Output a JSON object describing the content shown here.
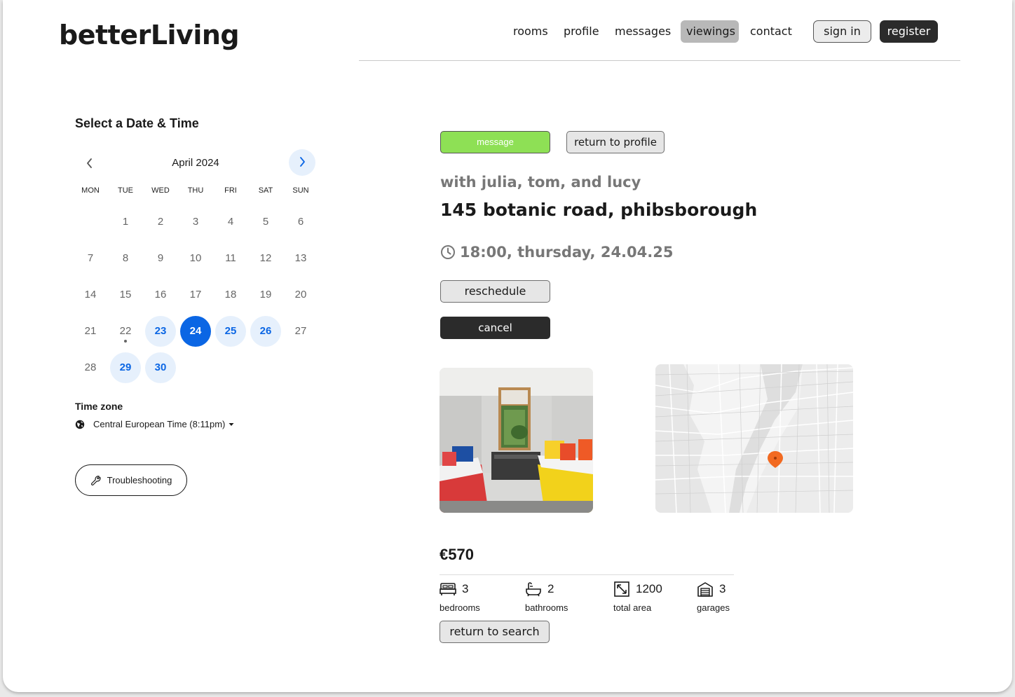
{
  "brand": "betterLiving",
  "nav": {
    "links": [
      "rooms",
      "profile",
      "messages",
      "viewings",
      "contact"
    ],
    "active": "viewings",
    "sign_in": "sign in",
    "register": "register"
  },
  "calendar": {
    "title": "Select a Date & Time",
    "month": "April 2024",
    "weekdays": [
      "MON",
      "TUE",
      "WED",
      "THU",
      "FRI",
      "SAT",
      "SUN"
    ],
    "days": [
      "1",
      "2",
      "3",
      "4",
      "5",
      "6",
      "7",
      "8",
      "9",
      "10",
      "11",
      "12",
      "13",
      "14",
      "15",
      "16",
      "17",
      "18",
      "19",
      "20",
      "21",
      "22",
      "23",
      "24",
      "25",
      "26",
      "27",
      "28",
      "29",
      "30"
    ],
    "first_weekday_index": 1,
    "available_days": [
      "23",
      "25",
      "26",
      "29",
      "30"
    ],
    "selected_day": "24",
    "today_day": "22",
    "timezone_title": "Time zone",
    "timezone_value": "Central European Time (8:11pm)",
    "troubleshooting": "Troubleshooting"
  },
  "viewing": {
    "message_button": "message",
    "return_profile_button": "return to profile",
    "with": "with julia, tom, and lucy",
    "address": "145 botanic road, phibsborough",
    "time": "18:00, thursday, 24.04.25",
    "reschedule_button": "reschedule",
    "cancel_button": "cancel",
    "price": "€570",
    "features": [
      {
        "icon": "bed-icon",
        "value": "3",
        "label": "bedrooms"
      },
      {
        "icon": "bathtub-icon",
        "value": "2",
        "label": "bathrooms"
      },
      {
        "icon": "area-icon",
        "value": "1200",
        "label": "total area"
      },
      {
        "icon": "garage-icon",
        "value": "3",
        "label": "garages"
      }
    ],
    "return_search_button": "return to search"
  },
  "colors": {
    "accent_blue": "#0b66e4",
    "accent_blue_light": "#e6f0fc",
    "green": "#8ee055",
    "dark": "#2b2b2b",
    "map_pin": "#f26a21"
  }
}
